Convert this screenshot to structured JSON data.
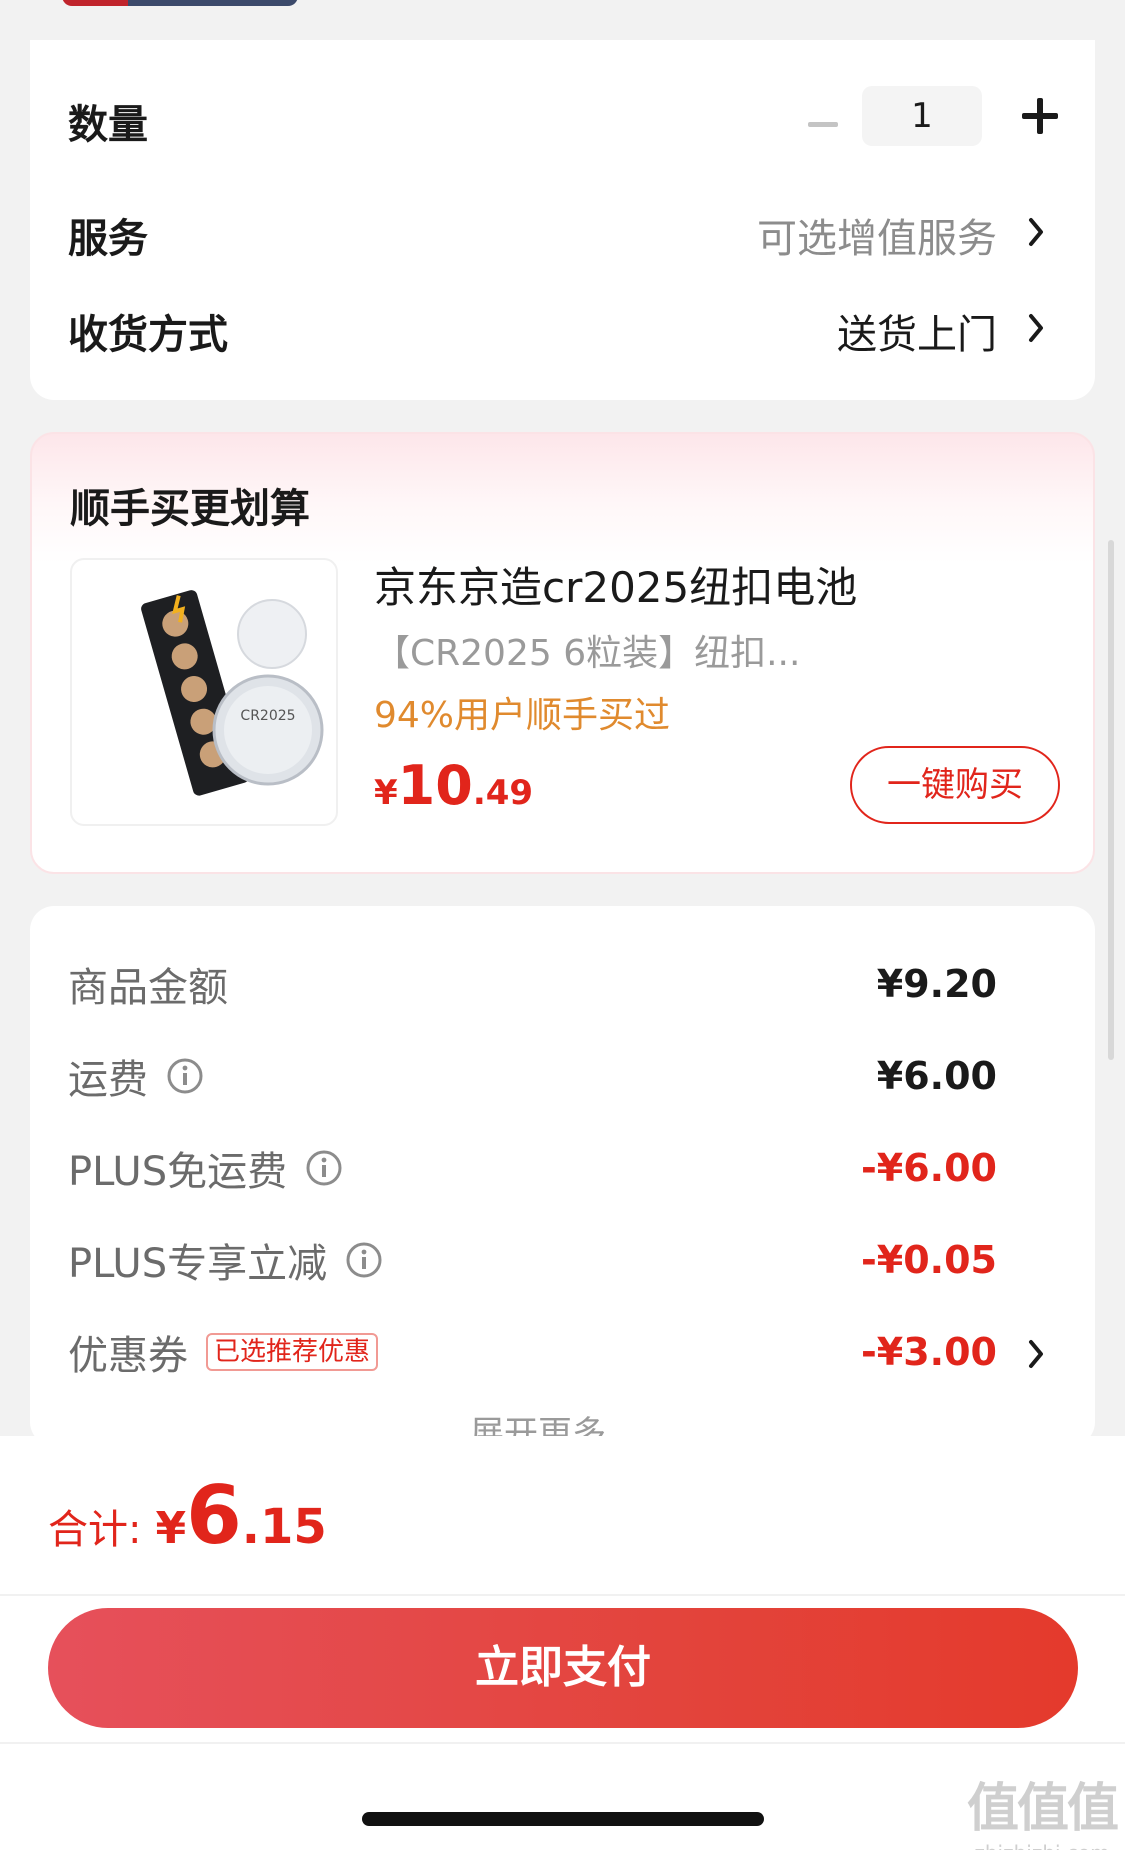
{
  "order": {
    "quantity_label": "数量",
    "quantity_value": "1",
    "service_label": "服务",
    "service_value": "可选增值服务",
    "delivery_label": "收货方式",
    "delivery_value": "送货上门"
  },
  "addon": {
    "title": "顺手买更划算",
    "product_name": "京东京造cr2025纽扣电池",
    "product_sub": "【CR2025 6粒装】纽扣...",
    "product_stat": "94%用户顺手买过",
    "price_symbol": "¥",
    "price_int": "10",
    "price_dec": ".49",
    "buy_label": "一键购买",
    "thumb_label": "CR2025"
  },
  "price_detail": {
    "rows": [
      {
        "label": "商品金额",
        "value": "¥9.20"
      },
      {
        "label": "运费",
        "value": "¥6.00"
      },
      {
        "label": "PLUS免运费",
        "value": "-¥6.00"
      },
      {
        "label": "PLUS专享立减",
        "value": "-¥0.05"
      },
      {
        "label": "优惠券",
        "value": "-¥3.00",
        "tag": "已选推荐优惠"
      }
    ],
    "expand_label": "展开更多"
  },
  "footer": {
    "total_label": "合计:",
    "total_symbol": "¥",
    "total_int": "6",
    "total_dec": ".15",
    "pay_label": "立即支付",
    "watermark": "值值值",
    "watermark_url": "zhizhizhi.com"
  },
  "colors": {
    "accent_red": "#e1251b",
    "stat_orange": "#e08a2e",
    "muted_gray": "#8c8c8c"
  }
}
